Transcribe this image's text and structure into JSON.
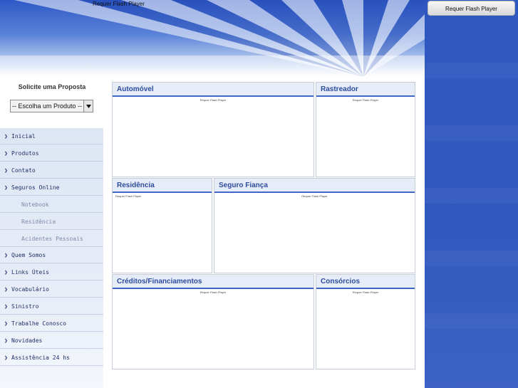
{
  "header": {
    "flash_text": "Requer Flash Player"
  },
  "right_column": {
    "flash_button_label": "Requer Flash Player"
  },
  "proposal": {
    "title": "Solicite uma Proposta",
    "select_value": "-- Escolha um Produto --"
  },
  "nav": {
    "items": [
      {
        "label": "Inicial"
      },
      {
        "label": "Produtos"
      },
      {
        "label": "Contato"
      },
      {
        "label": "Seguros Online"
      },
      {
        "label": "Notebook"
      },
      {
        "label": "Residência"
      },
      {
        "label": "Acidentes Pessoais"
      },
      {
        "label": "Quem Somos"
      },
      {
        "label": "Links Úteis"
      },
      {
        "label": "Vocabulário"
      },
      {
        "label": "Sinistro"
      },
      {
        "label": "Trabalhe Conosco"
      },
      {
        "label": "Novidades"
      },
      {
        "label": "Assistência 24 hs"
      }
    ]
  },
  "panels": {
    "automovel": {
      "title": "Automóvel",
      "flash": "Requer Flash Player"
    },
    "rastreador": {
      "title": "Rastreador",
      "flash": "Requer Flash Player"
    },
    "residencia": {
      "title": "Residência",
      "flash": "Requer Flash Player"
    },
    "seguro_fianca": {
      "title": "Seguro Fiança",
      "flash": "Requer Flash Player"
    },
    "creditos": {
      "title": "Créditos/Financiamentos",
      "flash": "Requer Flash Player"
    },
    "consorcios": {
      "title": "Consórcios",
      "flash": "Requer Flash Player"
    }
  },
  "colors": {
    "accent": "#4266c6",
    "panel_title": "#2d4c9e",
    "right_column": "#2f57c0"
  }
}
